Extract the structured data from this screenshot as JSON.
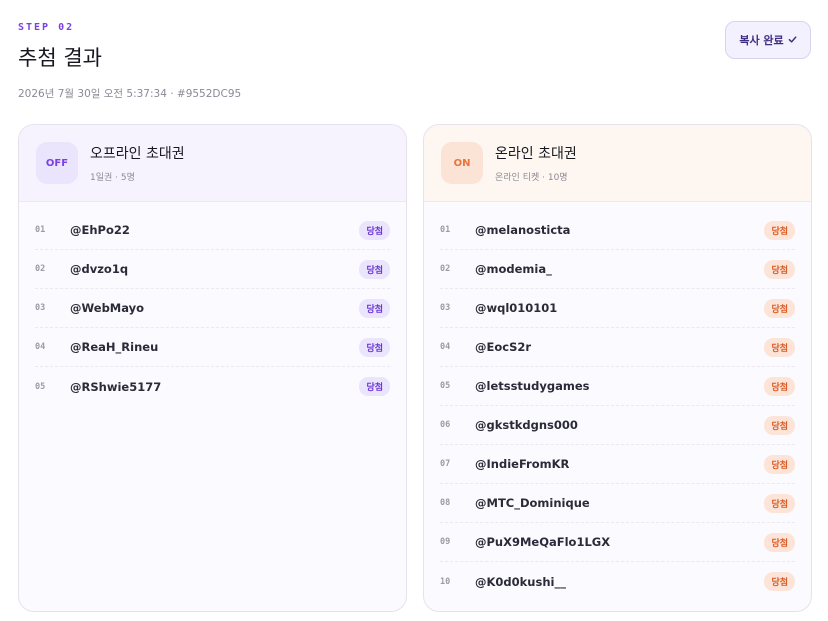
{
  "header": {
    "step": "STEP 02",
    "title": "추첨 결과",
    "meta": "2026년 7월 30일 오전 5:37:34 · #9552DC95"
  },
  "copy_button": {
    "label": "복사 완료",
    "icon": "check-icon"
  },
  "offline": {
    "badge": "OFF",
    "title": "오프라인 초대권",
    "subtitle": "1일권 · 5명",
    "color": "#7b3fe4",
    "winners": [
      {
        "num": "01",
        "handle": "@EhPo22",
        "status": "당첨"
      },
      {
        "num": "02",
        "handle": "@dvzo1q",
        "status": "당첨"
      },
      {
        "num": "03",
        "handle": "@WebMayo",
        "status": "당첨"
      },
      {
        "num": "04",
        "handle": "@ReaH_Rineu",
        "status": "당첨"
      },
      {
        "num": "05",
        "handle": "@RShwie5177",
        "status": "당첨"
      }
    ]
  },
  "online": {
    "badge": "ON",
    "title": "온라인 초대권",
    "subtitle": "온라인 티켓 · 10명",
    "color": "#e8743a",
    "winners": [
      {
        "num": "01",
        "handle": "@melanosticta",
        "status": "당첨"
      },
      {
        "num": "02",
        "handle": "@modemia_",
        "status": "당첨"
      },
      {
        "num": "03",
        "handle": "@wql010101",
        "status": "당첨"
      },
      {
        "num": "04",
        "handle": "@EocS2r",
        "status": "당첨"
      },
      {
        "num": "05",
        "handle": "@letsstudygames",
        "status": "당첨"
      },
      {
        "num": "06",
        "handle": "@gkstkdgns000",
        "status": "당첨"
      },
      {
        "num": "07",
        "handle": "@IndieFromKR",
        "status": "당첨"
      },
      {
        "num": "08",
        "handle": "@MTC_Dominique",
        "status": "당첨"
      },
      {
        "num": "09",
        "handle": "@PuX9MeQaFlo1LGX",
        "status": "당첨"
      },
      {
        "num": "10",
        "handle": "@K0d0kushi__",
        "status": "당첨"
      }
    ]
  }
}
